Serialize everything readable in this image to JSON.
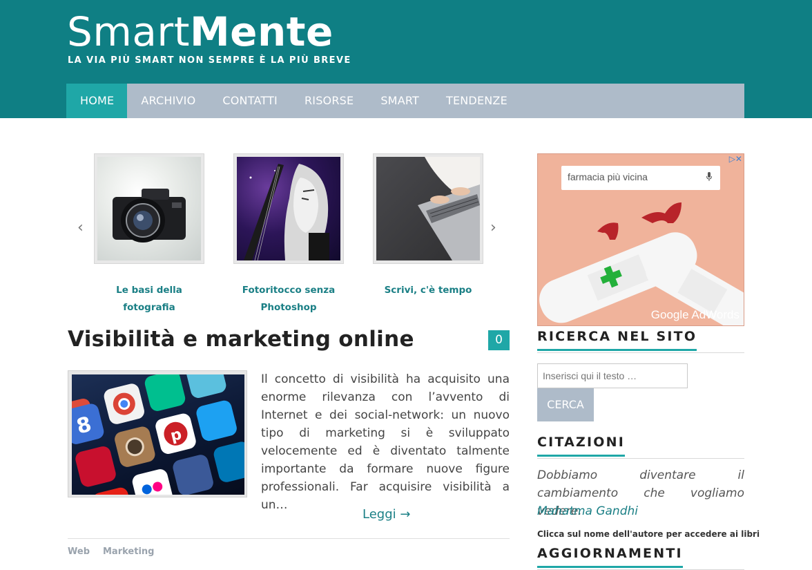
{
  "header": {
    "title_light": "Smart",
    "title_bold": "Mente",
    "tagline": "La via più smart non sempre è la più breve"
  },
  "nav": {
    "items": [
      {
        "label": "Home",
        "active": true
      },
      {
        "label": "Archivio"
      },
      {
        "label": "Contatti"
      },
      {
        "label": "Risorse"
      },
      {
        "label": "Smart"
      },
      {
        "label": "Tendenze"
      }
    ]
  },
  "carousel": {
    "prev": "‹",
    "next": "›",
    "slides": [
      {
        "caption": "Le basi della fotografia",
        "icon": "camera-photo"
      },
      {
        "caption": "Fotoritocco senza Photoshop",
        "icon": "guitar-portrait-photo"
      },
      {
        "caption": "Scrivi, c'è tempo",
        "icon": "laptop-typing-photo"
      }
    ]
  },
  "post": {
    "title": "Visibilità e marketing online",
    "comments": "0",
    "excerpt": "Il concetto di visibilità ha acquisito una enorme rilevanza con l’avvento di Internet e dei social-network: un nuovo tipo di marketing si è sviluppato velocemente ed è diventato talmente importante da formare nuove figure professionali. Far acquisire visibilità a un…",
    "read_more": "Leggi →",
    "tags": [
      "Web",
      "Marketing"
    ]
  },
  "ad": {
    "search_placeholder": "farmacia più vicina",
    "brand": "Google",
    "brand_suffix": "AdWords",
    "bg_color": "#f0b39b"
  },
  "sidebar": {
    "search_title": "Ricerca nel sito",
    "search_placeholder": "Inserisci qui il testo …",
    "search_button": "Cerca",
    "quotes_title": "Citazioni",
    "quote_text": "Dobbiamo diventare il cambiamento che vogliamo vedere.",
    "quote_author": "Mahatma Gandhi",
    "quote_note": "Clicca sul nome dell'autore per accedere ai libri",
    "updates_title": "Aggiornamenti"
  },
  "colors": {
    "header_bg": "#0f7f84",
    "accent": "#1fa7a7",
    "nav_bg": "#aebbc9",
    "link": "#1a7f85"
  }
}
